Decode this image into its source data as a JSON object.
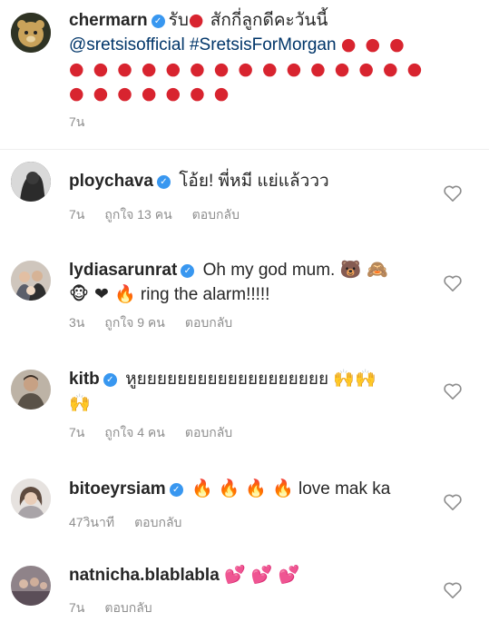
{
  "post": {
    "username": "chermarn",
    "verified": true,
    "text_prefix": "รับ",
    "text_suffix": "สักกี่ลูกดีคะวันนี้",
    "mention": "@sretsisofficial",
    "hashtag": "#SretsisForMorgan",
    "strawberry_row1": "● ● ●",
    "strawberry_row2": "● ● ● ● ● ● ● ● ● ● ● ● ● ● ●",
    "strawberry_row3": "● ● ● ● ● ● ●",
    "time": "7น"
  },
  "comments": [
    {
      "username": "ploychava",
      "text": "โอ้ย! พี่หมี แย่แล้ววว",
      "time": "7น",
      "likes": "ถูกใจ 13 คน",
      "reply": "ตอบกลับ",
      "avatar_color": "#3a3a3a"
    },
    {
      "username": "lydiasarunrat",
      "text": "Oh my god mum.",
      "text2": "ring the alarm!!!!!",
      "emoji1": "🐻 🙈",
      "emoji2": "🐵 ❤ 🔥",
      "time": "3น",
      "likes": "ถูกใจ 9 คน",
      "reply": "ตอบกลับ",
      "avatar_color": "#7a6a5a"
    },
    {
      "username": "kitb",
      "text": "หูยยยยยยยยยยยยยยยยยยย",
      "emoji1": "🙌🙌",
      "emoji2": "🙌",
      "time": "7น",
      "likes": "ถูกใจ 4 คน",
      "reply": "ตอบกลับ",
      "avatar_color": "#8a7a6a"
    },
    {
      "username": "bitoeyrsiam",
      "emoji1": "🔥 🔥 🔥 🔥",
      "text": "love mak ka",
      "time": "47วินาที",
      "reply": "ตอบกลับ",
      "avatar_color": "#b0aaa8"
    },
    {
      "username": "natnicha.blablabla",
      "emoji1": "💕 💕 💕",
      "time": "7น",
      "reply": "ตอบกลับ",
      "avatar_color": "#9a8f96"
    }
  ],
  "colors": {
    "link": "#003569",
    "verified": "#3897f0",
    "meta": "#8e8e8e",
    "strawberry": "#d8242f"
  }
}
